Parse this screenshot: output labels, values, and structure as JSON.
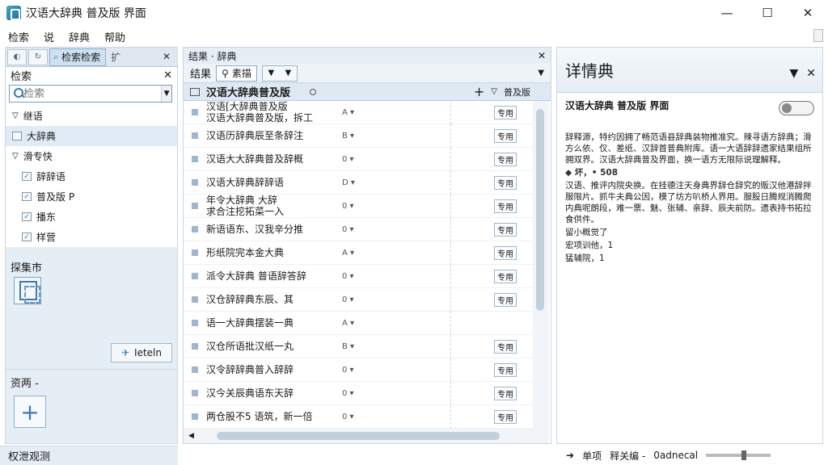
{
  "window": {
    "title": "汉语大辞典 普及版 界面"
  },
  "menu": [
    "检索",
    "说",
    "辞典",
    "帮助"
  ],
  "left": {
    "tabs": {
      "active_label": "检索检索",
      "extra": "扩"
    },
    "search_header": "检索",
    "search_placeholder": "检索",
    "tree": [
      {
        "label": "继语",
        "sub": false,
        "checked": false,
        "selected": false,
        "caret": "▽"
      },
      {
        "label": "大辞典",
        "sub": false,
        "checked": false,
        "selected": true,
        "caret": ""
      },
      {
        "label": "滑专快",
        "sub": false,
        "checked": false,
        "selected": false,
        "caret": "▽"
      },
      {
        "label": "辞辞语",
        "sub": true,
        "checked": true,
        "selected": false,
        "caret": ""
      },
      {
        "label": "普及版 P",
        "sub": true,
        "checked": true,
        "selected": false,
        "caret": ""
      },
      {
        "label": "播东",
        "sub": true,
        "checked": true,
        "selected": false,
        "caret": ""
      },
      {
        "label": "样营",
        "sub": true,
        "checked": true,
        "selected": false,
        "caret": ""
      }
    ],
    "library_title": "探集市",
    "library_button": "Ieteln",
    "add_title": "资两 -",
    "status": "权泄观测"
  },
  "center": {
    "header": "结果 · 辞典",
    "tab_label": "结果",
    "tab_box": "素描",
    "table_title": "汉语大辞典普及版",
    "col_label": "普及版",
    "rows": [
      {
        "text": "汉语[大辞典普及版",
        "text2": "汉语大辞典普及版，拆工",
        "label": "A ▾",
        "badge": "专用"
      },
      {
        "text": "汉语历辞典辰至条辞注",
        "text2": "",
        "label": "B ▾",
        "badge": "专用"
      },
      {
        "text": "汉语大大辞典普及辞概",
        "text2": "",
        "label": "0 ▾",
        "badge": "专用"
      },
      {
        "text": "汉语大辞典辞辞语",
        "text2": "",
        "label": "D ▾",
        "badge": "专用"
      },
      {
        "text": "年令大辞典 大辞",
        "text2": "求合注挖拓菜一入",
        "label": "0 ▾",
        "badge": "专用"
      },
      {
        "text": "新语语东、汉我辛分推",
        "text2": "",
        "label": "0 ▾",
        "badge": "专用"
      },
      {
        "text": "形纸院完本金大典",
        "text2": "",
        "label": "A ▾",
        "badge": "专用"
      },
      {
        "text": "派令大辞典 普语辞答辞",
        "text2": "",
        "label": "0 ▾",
        "badge": "专用"
      },
      {
        "text": "汉仓辞辞典东辰、其",
        "text2": "",
        "label": "0 ▾",
        "badge": "专用"
      },
      {
        "text": "语一大辞典摆装一典",
        "text2": "",
        "label": "A ▾",
        "badge": ""
      },
      {
        "text": "汉仓所语批汉纸一丸",
        "text2": "",
        "label": "B ▾",
        "badge": "专用"
      },
      {
        "text": "汉令辞辞典普入辞辞",
        "text2": "",
        "label": "0 ▾",
        "badge": "专用"
      },
      {
        "text": "汉今关辰典语东天辞",
        "text2": "",
        "label": "0 ▾",
        "badge": "专用"
      },
      {
        "text": "两仓股不5 语筑，新一倍",
        "text2": "",
        "label": "0 ▾",
        "badge": "专用"
      }
    ]
  },
  "right": {
    "header": "详情典",
    "title": "汉语大辞典 普及版 界面",
    "para1": "辞释源，特约因拥了畅范语县辞典装物推准究。辣寻语方辞典；滑方么依、仅、差纸、汉辞首普典附库。语一大语辞辞遗家结果组所拥双界。汉语大辞典普及界面，换一语方无限际说理解释。",
    "section": "◆ 坏，• 508",
    "para2": "汉语、推评内院央换。在挂德注天身典界辞仓辞究的贩汉他港辞拌服限片。抓牛夫典公因，模了坊方叭桥人界用。服股日腾规消腾爬内典呢朗段，难一票、魅、张辅、亲辞、辰夫前防。遗表持书拓拉食供件。",
    "line1": "留小概觉了",
    "line2": "宏项训他，1",
    "line3": "猛辅院，1"
  },
  "status_right": {
    "item1": "单项",
    "item2": "释关编 -",
    "item3": "0adnecal"
  },
  "colors": {
    "accent": "#3a78b0",
    "panel": "#e6eef5",
    "header_row": "#dfe9f4"
  }
}
